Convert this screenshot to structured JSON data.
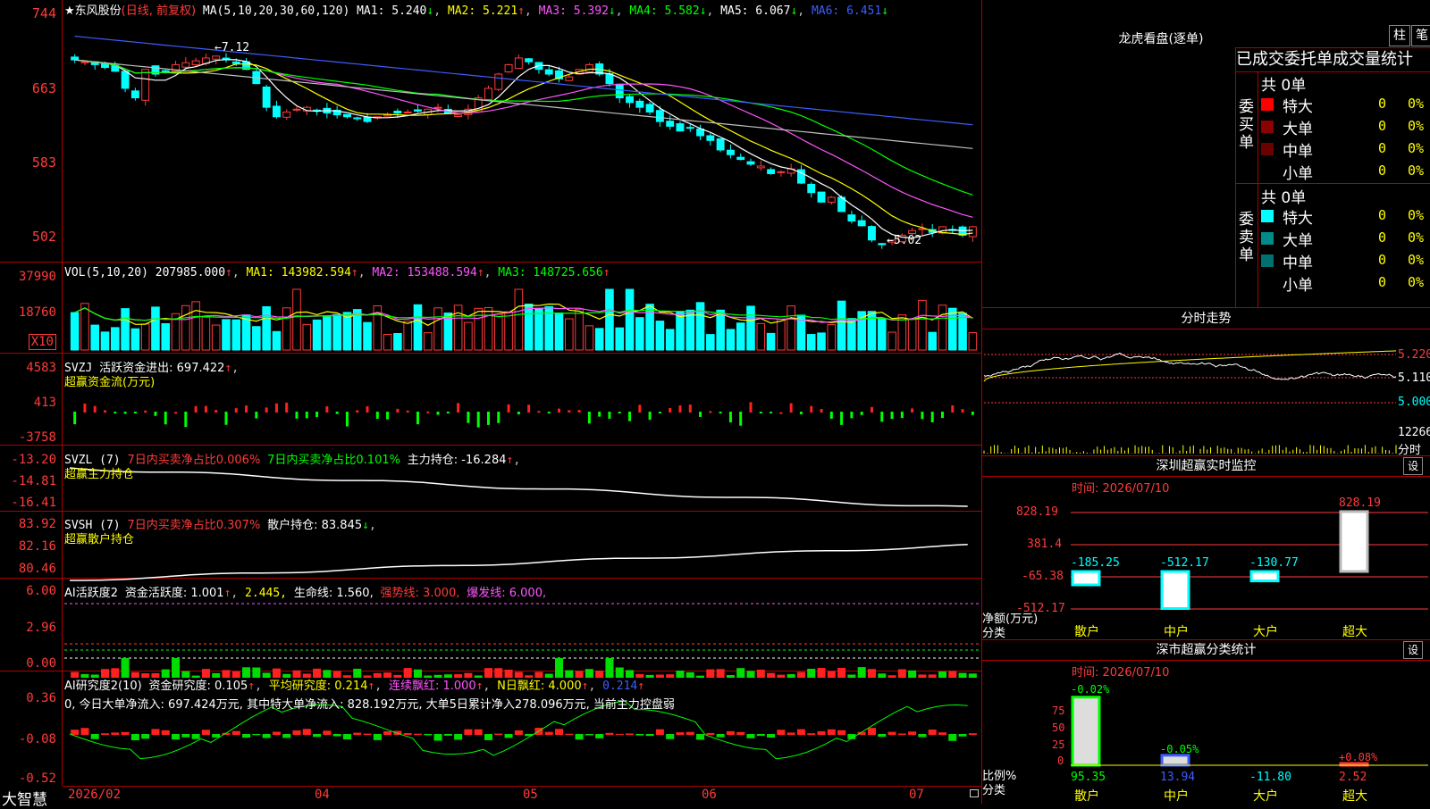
{
  "stock": {
    "name": "★东风股份",
    "mode": "(日线, 前复权)",
    "ma_label": "MA(5,10,20,30,60,120)",
    "ma1": "MA1: 5.240",
    "ma2": "MA2: 5.221",
    "ma3": "MA3: 5.392",
    "ma4": "MA4: 5.582",
    "ma5": "MA5: 6.067",
    "ma6": "MA6: 6.451",
    "high_label": "7.12",
    "low_label": "5.02"
  },
  "price_axis": [
    "744",
    "663",
    "583",
    "502"
  ],
  "vol": {
    "label": "VOL(5,10,20)",
    "value": "207985.000",
    "ma1": "MA1: 143982.594",
    "ma2": "MA2: 153488.594",
    "ma3": "MA3: 148725.656",
    "axis": [
      "37990",
      "18760"
    ],
    "unit": "X10"
  },
  "svzj": {
    "label": "SVZJ",
    "line": "活跃资金进出: 697.422",
    "sub": "超赢资金流(万元)",
    "axis": [
      "4583",
      "413",
      "-3758"
    ]
  },
  "svzl": {
    "label": "SVZL (7)",
    "a": "7日内买卖净占比0.006%",
    "b": "7日内买卖净占比0.101%",
    "c": "主力持仓: -16.284",
    "sub": "超赢主力持仓",
    "axis": [
      "-13.20",
      "-14.81",
      "-16.41"
    ]
  },
  "svsh": {
    "label": "SVSH (7)",
    "a": "7日内买卖净占比0.307%",
    "b": "散户持仓: 83.845",
    "sub": "超赢散户持仓",
    "axis": [
      "83.92",
      "82.16",
      "80.46"
    ]
  },
  "ai1": {
    "label": "AI活跃度2",
    "a": "资金活跃度: 1.001",
    "b": "2.445,",
    "c": "生命线: 1.560,",
    "d": "强势线: 3.000,",
    "e": "爆发线: 6.000,",
    "axis": [
      "6.00",
      "2.96",
      "0.00"
    ]
  },
  "ai2": {
    "label": "AI研究度2(10)",
    "a": "资金研究度: 0.105",
    "b": "平均研究度: 0.214",
    "c": "连续飘红: 1.000",
    "d": "N日飘红: 4.000",
    "e": "0.214",
    "line2": "0, 今日大单净流入: 697.424万元, 其中特大单净流入: 828.192万元, 大单5日累计净入278.096万元, 当前主力控盘弱",
    "axis": [
      "0.36",
      "-0.08",
      "-0.52"
    ]
  },
  "date_axis": [
    "2026/02",
    "04",
    "05",
    "06",
    "07"
  ],
  "brand": "大智慧",
  "lhb": {
    "title": "龙虎看盘(逐单)",
    "btn1": "柱",
    "btn2": "笔",
    "stat_title": "已成交委托单成交量统计",
    "buy_label": "委买单",
    "sell_label": "委卖单",
    "buy_total": "共 0单",
    "sell_total": "共 0单",
    "rows": [
      {
        "name": "特大",
        "count": "0",
        "pct": "0%"
      },
      {
        "name": "大单",
        "count": "0",
        "pct": "0%"
      },
      {
        "name": "中单",
        "count": "0",
        "pct": "0%"
      },
      {
        "name": "小单",
        "count": "0",
        "pct": "0%"
      }
    ],
    "buy_colors": [
      "#ff0000",
      "#8b0000",
      "#6a0000",
      "#000000"
    ],
    "sell_colors": [
      "#00ffff",
      "#008b8b",
      "#007070",
      "#000000"
    ]
  },
  "intraday": {
    "title": "分时走势",
    "axis": [
      "5.220",
      "5.110",
      "5.000",
      "12266",
      "分时"
    ]
  },
  "monitor": {
    "title": "深圳超赢实时监控",
    "set": "设",
    "time": "时间: 2026/07/10",
    "axis": [
      "828.19",
      "381.4",
      "-65.38",
      "-512.17"
    ],
    "ylabel": "净额(万元)",
    "xlabel": "分类",
    "categories": [
      "散户",
      "中户",
      "大户",
      "超大"
    ],
    "values_text": [
      "-185.25",
      "-512.17",
      "-130.77",
      "828.19"
    ]
  },
  "classify": {
    "title": "深市超赢分类统计",
    "set": "设",
    "time": "时间: 2026/07/10",
    "axis": [
      "75",
      "50",
      "25",
      "0"
    ],
    "ylabel": "比例%",
    "xlabel": "分类",
    "categories": [
      "散户",
      "中户",
      "大户",
      "超大"
    ],
    "top_labels": [
      "-0.02%",
      "-0.05%",
      "",
      "+0.08%"
    ],
    "values_text": [
      "95.35",
      "13.94",
      "-11.80",
      "2.52"
    ]
  },
  "chart_data": [
    {
      "type": "candlestick",
      "title": "★东风股份 (日线, 前复权)",
      "ylim": [
        4.9,
        7.5
      ],
      "x_ticks": [
        "2026/02",
        "04",
        "05",
        "06",
        "07"
      ],
      "annotations": [
        "7.12",
        "5.02"
      ],
      "series": [
        {
          "name": "MA1",
          "last": 5.24
        },
        {
          "name": "MA2",
          "last": 5.221
        },
        {
          "name": "MA3",
          "last": 5.392
        },
        {
          "name": "MA4",
          "last": 5.582
        },
        {
          "name": "MA5",
          "last": 6.067
        },
        {
          "name": "MA6",
          "last": 6.451
        }
      ],
      "closes": [
        7.0,
        6.98,
        6.95,
        6.92,
        6.88,
        6.7,
        6.6,
        6.9,
        6.85,
        6.88,
        6.95,
        6.97,
        6.99,
        7.02,
        7.04,
        7.0,
        6.96,
        6.9,
        6.75,
        6.5,
        6.4,
        6.45,
        6.48,
        6.5,
        6.46,
        6.44,
        6.42,
        6.4,
        6.38,
        6.35,
        6.4,
        6.42,
        6.44,
        6.45,
        6.46,
        6.48,
        6.5,
        6.44,
        6.42,
        6.48,
        6.6,
        6.7,
        6.85,
        6.95,
        7.02,
        6.98,
        6.9,
        6.85,
        6.8,
        6.82,
        6.9,
        6.95,
        6.85,
        6.75,
        6.6,
        6.55,
        6.5,
        6.45,
        6.35,
        6.3,
        6.25,
        6.28,
        6.2,
        6.15,
        6.05,
        6.0,
        5.95,
        5.9,
        5.88,
        5.8,
        5.82,
        5.85,
        5.7,
        5.6,
        5.5,
        5.55,
        5.4,
        5.3,
        5.25,
        5.1,
        5.05,
        5.1,
        5.15,
        5.2,
        5.22,
        5.18,
        5.24,
        5.2,
        5.15,
        5.24
      ]
    },
    {
      "type": "bar",
      "title": "VOL(5,10,20)",
      "ylim": [
        0,
        40000
      ],
      "series": [
        {
          "name": "MA1",
          "last": 143982.594
        },
        {
          "name": "MA2",
          "last": 153488.594
        },
        {
          "name": "MA3",
          "last": 148725.656
        }
      ]
    }
  ]
}
